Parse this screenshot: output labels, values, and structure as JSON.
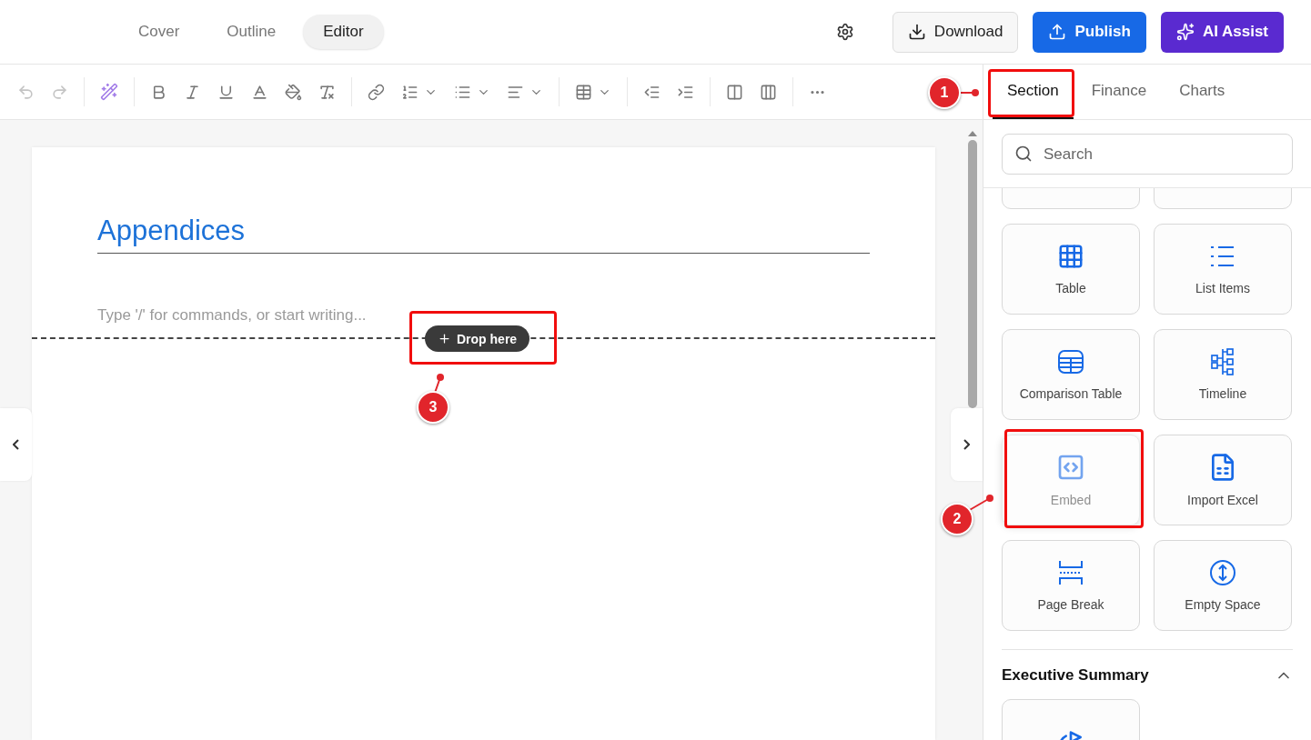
{
  "top_tabs": [
    {
      "label": "Cover",
      "selected": false
    },
    {
      "label": "Outline",
      "selected": false
    },
    {
      "label": "Editor",
      "selected": true
    }
  ],
  "actions": [
    {
      "kind": "download",
      "label": "Download"
    },
    {
      "kind": "publish",
      "label": "Publish"
    },
    {
      "kind": "ai",
      "label": "AI Assist"
    }
  ],
  "history": [
    {
      "kind": "undo",
      "disabled": true
    },
    {
      "kind": "redo",
      "disabled": true
    }
  ],
  "document": {
    "heading": "Appendices",
    "placeholder": "Type '/' for commands, or start writing...",
    "drop_label": "Drop here"
  },
  "panel": {
    "tabs": [
      {
        "label": "Section",
        "selected": true
      },
      {
        "label": "Finance",
        "selected": false
      },
      {
        "label": "Charts",
        "selected": false
      }
    ],
    "search": {
      "placeholder": "Search"
    },
    "blocks": [
      {
        "kind": "cut"
      },
      {
        "kind": "cut"
      },
      {
        "kind": "table",
        "label": "Table",
        "dimmed": false
      },
      {
        "kind": "list",
        "label": "List Items",
        "dimmed": false
      },
      {
        "kind": "comparison",
        "label": "Comparison Table",
        "dimmed": false
      },
      {
        "kind": "timeline",
        "label": "Timeline",
        "dimmed": false
      },
      {
        "kind": "embed",
        "label": "Embed",
        "dimmed": true
      },
      {
        "kind": "excel",
        "label": "Import Excel",
        "dimmed": false
      },
      {
        "kind": "pagebreak",
        "label": "Page Break",
        "dimmed": false
      },
      {
        "kind": "space",
        "label": "Empty Space",
        "dimmed": false
      }
    ],
    "sections": [
      {
        "title": "Executive Summary",
        "expanded": true,
        "blocks": [
          {
            "kind": "target"
          }
        ]
      }
    ]
  },
  "callouts": [
    {
      "number": "1"
    },
    {
      "number": "2"
    },
    {
      "number": "3"
    }
  ]
}
